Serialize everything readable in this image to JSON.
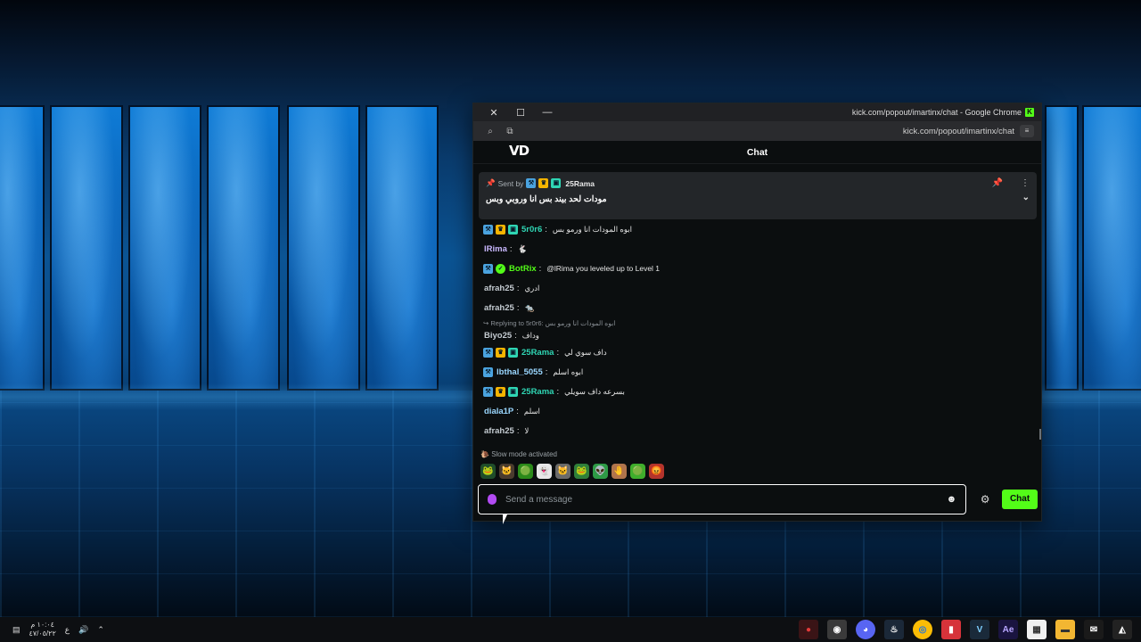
{
  "window": {
    "title": "kick.com/popout/imartinx/chat - Google Chrome",
    "url": "kick.com/popout/imartinx/chat",
    "brand_letter": "K"
  },
  "chat": {
    "header": "Chat",
    "logo": "VD",
    "pinned": {
      "sent_by": "Sent by",
      "user": "25Rama",
      "message": "مودات لحد بيند بس انا وروبي وبس"
    },
    "messages": [
      {
        "badges": [
          "blue",
          "gold",
          "teal"
        ],
        "user": "5r0r6",
        "color": "#2fd6b4",
        "text": "ابوه المودات انا ورمو بس"
      },
      {
        "badges": [],
        "user": "lRima",
        "color": "#c9b8ff",
        "text": "🐇"
      },
      {
        "badges": [
          "blue",
          "green"
        ],
        "user": "BotRix",
        "color": "#53fc18",
        "text": "@lRima you leveled up to Level 1"
      },
      {
        "badges": [],
        "user": "afrah25",
        "color": "#c4cbd1",
        "text": "ادري"
      },
      {
        "badges": [],
        "user": "afrah25",
        "color": "#c4cbd1",
        "text": "🐀"
      },
      {
        "reply": "Replying to 5r0r6: ابوه المودات انا ورمو بس",
        "badges": [],
        "user": "Biyo25",
        "color": "#c4cbd1",
        "text": "وداف"
      },
      {
        "badges": [
          "blue",
          "gold",
          "teal"
        ],
        "user": "25Rama",
        "color": "#2fd6b4",
        "text": "داف سوي لي"
      },
      {
        "badges": [
          "blue"
        ],
        "user": "lbthal_5055",
        "color": "#9ad7ff",
        "text": "ابوه اسلم"
      },
      {
        "badges": [
          "blue",
          "gold",
          "teal"
        ],
        "user": "25Rama",
        "color": "#2fd6b4",
        "text": "بسرعه داف سويلي"
      },
      {
        "badges": [],
        "user": "diala1P",
        "color": "#9ad7ff",
        "text": "اسلم"
      },
      {
        "badges": [],
        "user": "afrah25",
        "color": "#c4cbd1",
        "text": "لا"
      }
    ],
    "slow_mode": "Slow mode activated",
    "emotes": [
      "🐸",
      "🐱",
      "🟢",
      "👻",
      "🐱",
      "🐸",
      "👽",
      "🤚",
      "🟢",
      "😡"
    ],
    "input_placeholder": "Send a message",
    "send_label": "Chat"
  },
  "taskbar": {
    "time": "١٠:٠٤ م",
    "date": "٤٧/٠٥/٢٢",
    "lang": "ع",
    "apps": [
      "red-app",
      "obs",
      "discord",
      "steam",
      "chrome",
      "red-tool",
      "vegas",
      "ae",
      "store",
      "files",
      "mail",
      "ml"
    ]
  },
  "colors": {
    "accent": "#53fc18",
    "bg": "#0b0e0f"
  }
}
